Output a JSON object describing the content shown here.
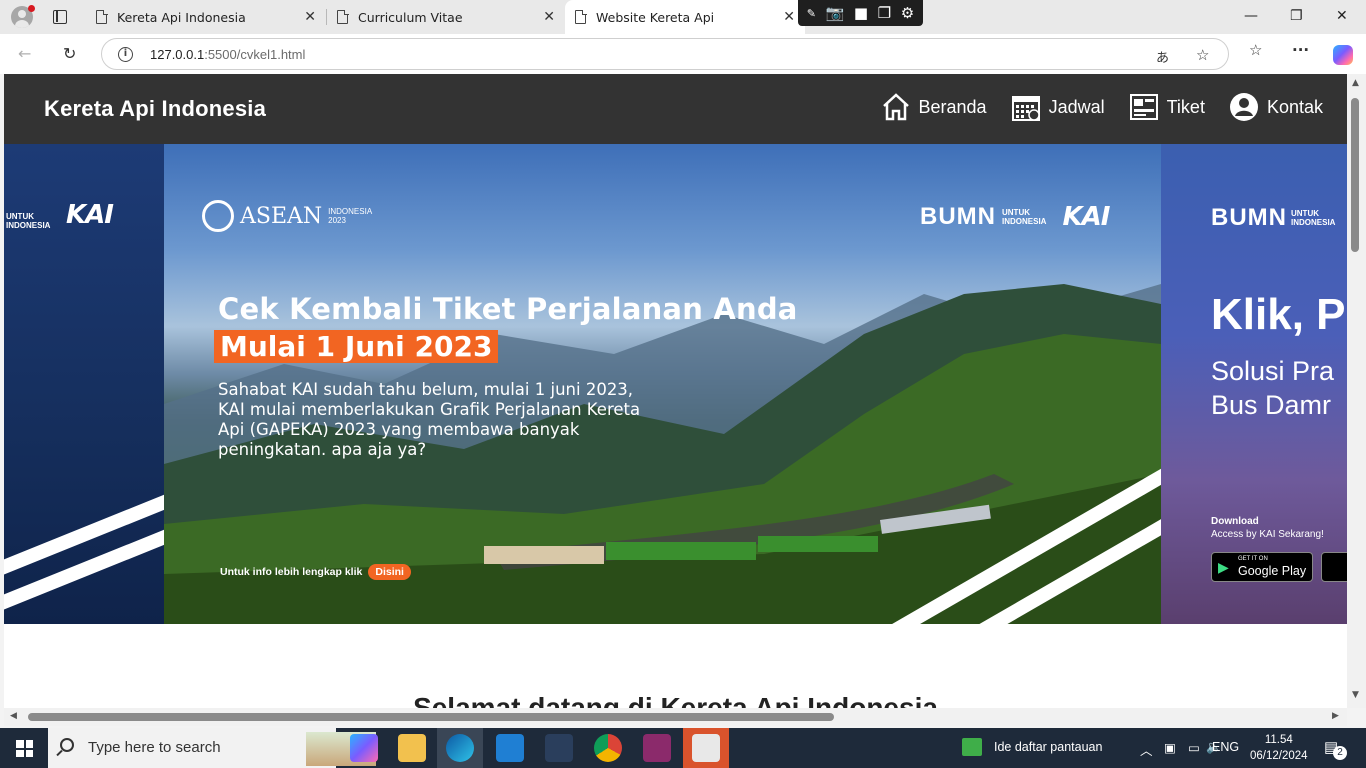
{
  "browser": {
    "tabs": [
      {
        "title": "Kereta Api Indonesia"
      },
      {
        "title": "Curriculum Vitae"
      },
      {
        "title": "Website Kereta Api"
      }
    ],
    "url_host": "127.0.0.1",
    "url_rest": ":5500/cvkel1.html"
  },
  "site": {
    "title": "Kereta Api Indonesia",
    "nav": [
      {
        "label": "Beranda",
        "icon": "home-icon"
      },
      {
        "label": "Jadwal",
        "icon": "calendar-icon"
      },
      {
        "label": "Tiket",
        "icon": "ticket-icon"
      },
      {
        "label": "Kontak",
        "icon": "user-icon"
      }
    ]
  },
  "banner": {
    "left": {
      "small": "UNTUK\nINDONESIA",
      "logo": "KAI"
    },
    "main": {
      "asean": "ASEAN",
      "asean_sub": "INDONESIA\n2023",
      "bumn": "BUMN",
      "bumn_sub": "UNTUK\nINDONESIA",
      "logo": "KAI",
      "headline": "Cek Kembali  Tiket Perjalanan Anda",
      "tag": "Mulai 1 Juni 2023",
      "paragraph": "Sahabat KAI sudah tahu belum, mulai 1 juni 2023, KAI mulai memberlakukan Grafik Perjalanan Kereta Api (GAPEKA) 2023 yang membawa banyak peningkatan. apa aja ya?",
      "info": "Untuk info lebih lengkap klik",
      "info_button": "Disini"
    },
    "right": {
      "bumn": "BUMN",
      "bumn_sub": "UNTUK\nINDONESIA",
      "headline": "Klik, P",
      "sub1": "Solusi Pra",
      "sub2": "Bus Damr",
      "download": "Download",
      "download_sub": "Access by KAI Sekarang!",
      "store_small": "GET IT ON",
      "store": "Google Play"
    }
  },
  "welcome": "Selamat datang di Kereta Api Indonesia",
  "taskbar": {
    "search_placeholder": "Type here to search",
    "notification": "Ide daftar pantauan",
    "lang": "ENG",
    "time": "11.54",
    "date": "06/12/2024",
    "badge": "2"
  }
}
